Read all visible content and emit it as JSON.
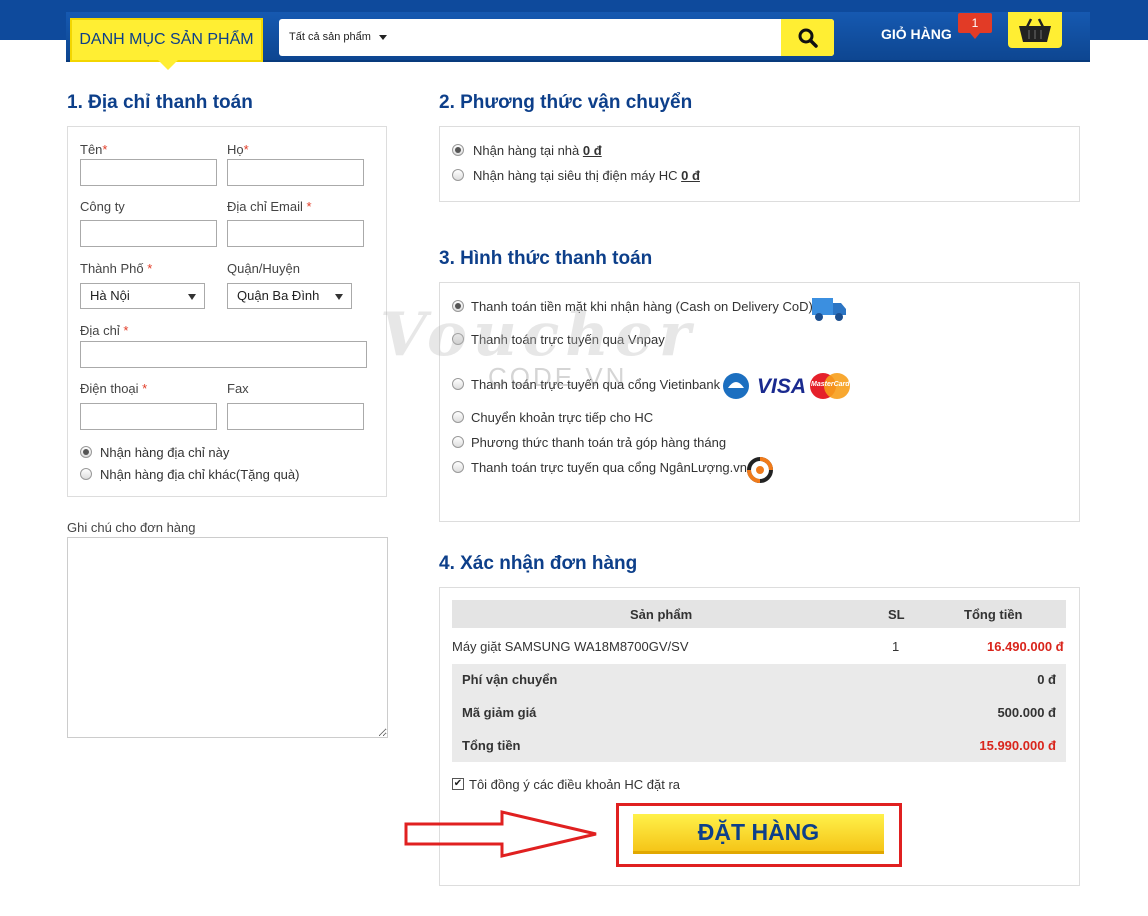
{
  "header": {
    "category_button": "DANH MỤC SẢN PHẨM",
    "search_select": "Tất cả sản phẩm",
    "cart_label": "GIỎ HÀNG",
    "cart_count": "1"
  },
  "billing": {
    "title": "1.  Địa chỉ thanh toán",
    "first_name_label": "Tên",
    "last_name_label": "Họ",
    "company_label": "Công ty",
    "email_label": "Địa chỉ Email ",
    "city_label": "Thành Phố ",
    "district_label": "Quận/Huyện",
    "city_value": "Hà Nội",
    "district_value": "Quận Ba Đình",
    "address_label": "Địa chỉ ",
    "phone_label": "Điện thoại ",
    "fax_label": "Fax",
    "required_mark": "*",
    "ship_option_1": "Nhận hàng địa chỉ này",
    "ship_option_2": "Nhận hàng địa chỉ khác(Tặng quà)",
    "note_label": "Ghi chú cho đơn hàng"
  },
  "shipping": {
    "title": "2.  Phương thức vận chuyển",
    "options": [
      {
        "label": "Nhận hàng tại nhà ",
        "price": "0 đ"
      },
      {
        "label": "Nhận hàng tại siêu thị điện máy HC ",
        "price": "0 đ"
      }
    ]
  },
  "payment": {
    "title": "3.  Hình thức thanh toán",
    "options": [
      "Thanh toán tiền mặt khi nhận hàng (Cash on Delivery CoD)",
      "Thanh toán trực tuyến qua Vnpay",
      "Thanh toán trực tuyến qua cổng Vietinbank",
      "Chuyển khoản trực tiếp cho HC",
      "Phương thức thanh toán trả góp hàng tháng",
      "Thanh toán trực tuyến qua cổng NgânLượng.vn"
    ],
    "visa": "VISA",
    "mastercard": "MasterCard"
  },
  "confirm": {
    "title": "4.  Xác nhận đơn hàng",
    "col_product": "Sản phẩm",
    "col_qty": "SL",
    "col_total": "Tổng tiền",
    "item_name": "Máy giặt SAMSUNG WA18M8700GV/SV",
    "item_qty": "1",
    "item_total": "16.490.000 đ",
    "shipping_fee_label": "Phí vận chuyển",
    "shipping_fee": "0 đ",
    "discount_label": "Mã giảm giá",
    "discount": "500.000 đ",
    "grand_total_label": "Tổng tiền",
    "grand_total": "15.990.000 đ",
    "terms": "Tôi đồng ý các điều khoản HC đặt ra",
    "order_button": "ĐẶT HÀNG"
  },
  "watermark": {
    "line1": "Voucher",
    "line2": "CODE.VN"
  }
}
